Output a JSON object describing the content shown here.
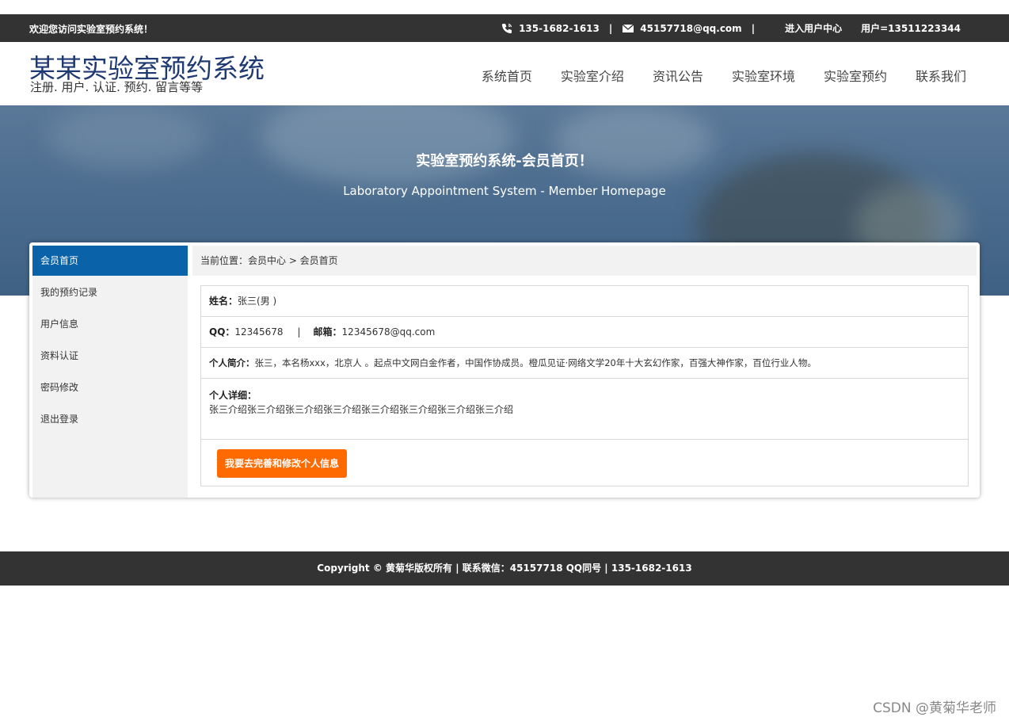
{
  "topbar": {
    "welcome": "欢迎您访问实验室预约系统！",
    "phone": "135-1682-1613",
    "separator": "|",
    "email": "45157718@qq.com",
    "separator2": "|",
    "user_center": "进入用户中心",
    "user": "用户=13511223344",
    "phone_icon": "phone-icon",
    "mail_icon": "mail-icon"
  },
  "header": {
    "title": "某某实验室预约系统",
    "subtitle": "注册. 用户. 认证. 预约. 留言等等",
    "nav": [
      "系统首页",
      "实验室介绍",
      "资讯公告",
      "实验室环境",
      "实验室预约",
      "联系我们"
    ]
  },
  "banner": {
    "title": "实验室预约系统-会员首页！",
    "subtitle": "Laboratory Appointment System - Member Homepage"
  },
  "sidebar": {
    "items": [
      "会员首页",
      "我的预约记录",
      "用户信息",
      "资料认证",
      "密码修改",
      "退出登录"
    ],
    "active_index": 0
  },
  "breadcrumb": "当前位置：会员中心 > 会员首页",
  "profile": {
    "name_label": "姓名：",
    "name_value": "张三(男 )",
    "qq_label": "QQ：",
    "qq_value": "12345678",
    "divider": "|",
    "email_label": "邮箱：",
    "email_value": "12345678@qq.com",
    "intro_label": "个人简介：",
    "intro_value": "张三，本名杨xxx，北京人 。起点中文网白金作者，中国作协成员。橙瓜见证·网络文学20年十大玄幻作家，百强大神作家，百位行业人物。",
    "detail_label": "个人详细：",
    "detail_value": "张三介绍张三介绍张三介绍张三介绍张三介绍张三介绍张三介绍张三介绍",
    "edit_button": "我要去完善和修改个人信息"
  },
  "footer": "Copyright © 黄菊华版权所有 | 联系微信：45157718 QQ同号 | 135-1682-1613",
  "watermark": "CSDN @黄菊华老师",
  "colors": {
    "topbar": "#333333",
    "logo": "#1f3a73",
    "active_sidebar": "#0a63a8",
    "button": "#ff6a00"
  }
}
